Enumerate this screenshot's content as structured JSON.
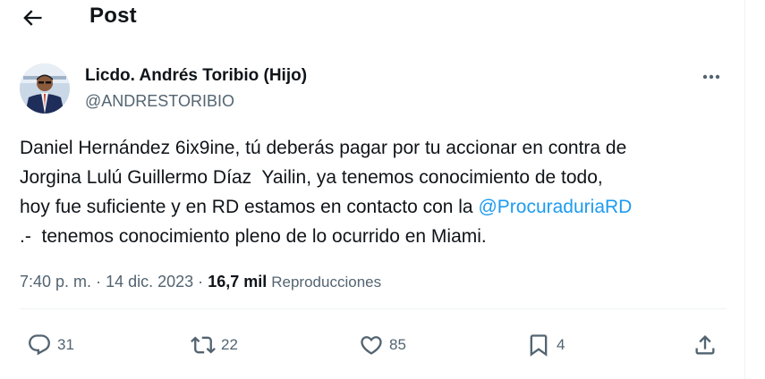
{
  "header": {
    "title": "Post",
    "back_icon": "arrow-left-icon"
  },
  "author": {
    "name": "Licdo. Andrés Toribio (Hijo)",
    "handle": "@ANDRESTORIBIO",
    "more_icon": "more-horizontal-icon"
  },
  "post": {
    "lines": [
      "Daniel Hernández 6ix9ine, tú deberás pagar por tu accionar en contra de",
      "Jorgina Lulú Guillermo Díaz  Yailin, ya tenemos conocimiento de todo,",
      "hoy fue suficiente y en RD estamos en contacto con la ",
      ".-  tenemos conocimiento pleno de lo ocurrido en Miami."
    ],
    "mention": "@ProcuraduriaRD"
  },
  "meta": {
    "time": "7:40 p. m.",
    "separator": "·",
    "date": "14 dic. 2023",
    "views_count": "16,7 mil",
    "views_label": "Reproducciones"
  },
  "actions": {
    "replies": "31",
    "reposts": "22",
    "likes": "85",
    "bookmarks": "4"
  },
  "colors": {
    "link": "#1d9bf0",
    "secondary_text": "#536471",
    "divider": "#eff3f4"
  }
}
